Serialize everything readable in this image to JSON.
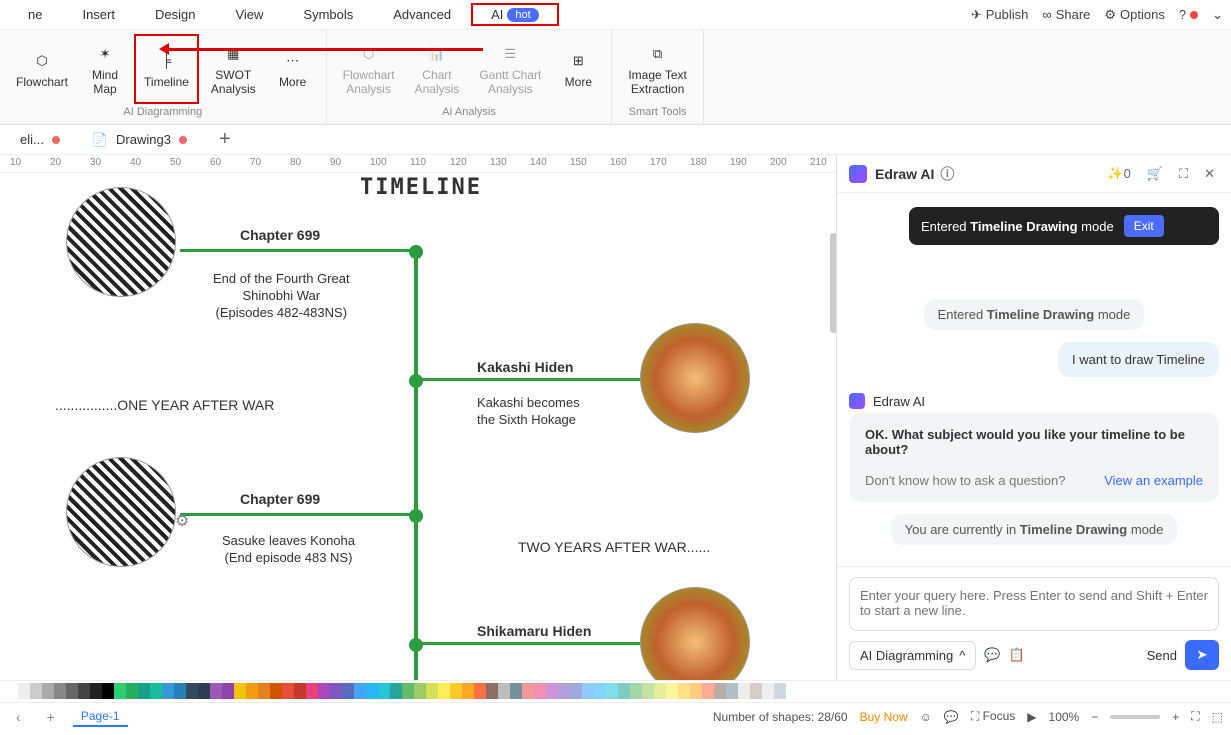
{
  "menubar": {
    "items": [
      "ne",
      "Insert",
      "Design",
      "View",
      "Symbols",
      "Advanced",
      "AI"
    ],
    "hot": "hot",
    "right": {
      "publish": "Publish",
      "share": "Share",
      "options": "Options"
    }
  },
  "ribbon": {
    "g1": {
      "name": "AI Diagramming",
      "tools": {
        "flowchart": "Flowchart",
        "mindmap": "Mind\nMap",
        "timeline": "Timeline",
        "swot": "SWOT\nAnalysis",
        "more": "More"
      }
    },
    "g2": {
      "name": "AI Analysis",
      "tools": {
        "fca": "Flowchart\nAnalysis",
        "ca": "Chart\nAnalysis",
        "gca": "Gantt Chart\nAnalysis",
        "more": "More"
      }
    },
    "g3": {
      "name": "Smart Tools",
      "tools": {
        "ite": "Image Text\nExtraction"
      }
    }
  },
  "tabs": {
    "t1": "eli...",
    "t2": "Drawing3"
  },
  "ruler_ticks": [
    10,
    20,
    30,
    40,
    50,
    60,
    70,
    80,
    90,
    100,
    110,
    120,
    130,
    140,
    150,
    160,
    170,
    180,
    190,
    200,
    210
  ],
  "timeline": {
    "title": "TIMELINE",
    "n1_title": "Chapter 699",
    "n1_desc": "End of the Fourth Great\nShinobhi War\n(Episodes 482-483NS)",
    "sec1": "................ONE YEAR AFTER WAR",
    "n2_title": "Kakashi Hiden",
    "n2_desc": "Kakashi becomes\nthe Sixth Hokage",
    "n3_title": "Chapter 699",
    "n3_desc": "Sasuke leaves Konoha\n(End episode 483 NS)",
    "sec2": "TWO YEARS AFTER WAR......",
    "n4_title": "Shikamaru Hiden"
  },
  "ai": {
    "header": "Edraw AI",
    "credits": "0",
    "toast_pre": "Entered ",
    "toast_b": "Timeline Drawing",
    "toast_post": " mode",
    "exit": "Exit",
    "sys_pre": "Entered ",
    "sys_b": "Timeline Drawing",
    "sys_post": " mode",
    "user": "I want to draw Timeline",
    "ai_name": "Edraw AI",
    "prompt": "OK. What subject would you like your timeline to be about?",
    "subprompt": "Don't know how to ask a question?",
    "example": "View an example",
    "status_pre": "You are currently in ",
    "status_b": "Timeline Drawing",
    "status_post": " mode",
    "placeholder": "Enter your query here. Press Enter to send and Shift + Enter to start a new line.",
    "mode": "AI Diagramming",
    "send": "Send"
  },
  "status": {
    "page": "Page-1",
    "shapes_label": "Number of shapes: ",
    "shapes": "28/60",
    "buy": "Buy Now",
    "focus": "Focus",
    "zoom": "100%"
  },
  "palette": [
    "#fff",
    "#eee",
    "#ccc",
    "#aaa",
    "#888",
    "#666",
    "#444",
    "#222",
    "#000",
    "#2ecc71",
    "#27ae60",
    "#16a085",
    "#1abc9c",
    "#3498db",
    "#2980b9",
    "#34495e",
    "#2c3e50",
    "#9b59b6",
    "#8e44ad",
    "#f1c40f",
    "#f39c12",
    "#e67e22",
    "#d35400",
    "#e74c3c",
    "#c0392b",
    "#ec407a",
    "#ab47bc",
    "#7e57c2",
    "#5c6bc0",
    "#42a5f5",
    "#29b6f6",
    "#26c6da",
    "#26a69a",
    "#66bb6a",
    "#9ccc65",
    "#d4e157",
    "#ffee58",
    "#ffca28",
    "#ffa726",
    "#ff7043",
    "#8d6e63",
    "#bdbdbd",
    "#78909c",
    "#ef9a9a",
    "#f48fb1",
    "#ce93d8",
    "#b39ddb",
    "#9fa8da",
    "#90caf9",
    "#81d4fa",
    "#80deea",
    "#80cbc4",
    "#a5d6a7",
    "#c5e1a5",
    "#e6ee9c",
    "#fff59d",
    "#ffe082",
    "#ffcc80",
    "#ffab91",
    "#bcaaa4",
    "#b0bec5",
    "#efebe9",
    "#d7ccc8",
    "#eceff1",
    "#cfd8dc"
  ]
}
